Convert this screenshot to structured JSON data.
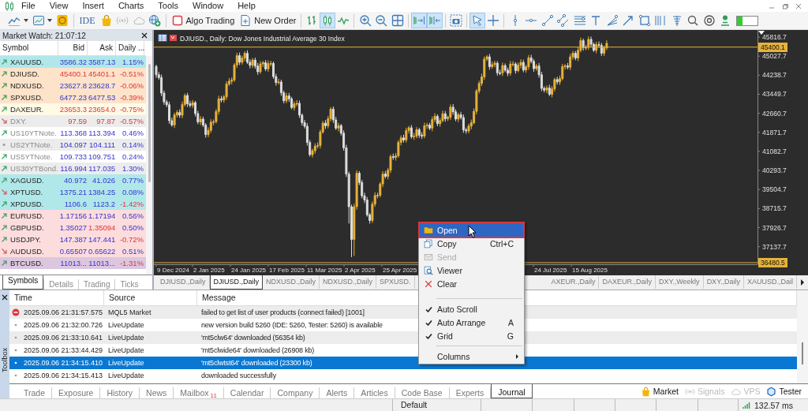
{
  "menu": {
    "items": [
      "File",
      "View",
      "Insert",
      "Charts",
      "Tools",
      "Window",
      "Help"
    ]
  },
  "toolbar": {
    "ide": {
      "label": "IDE"
    },
    "algo_trading": {
      "label": "Algo Trading",
      "on": false
    },
    "new_order": {
      "label": "New Order"
    },
    "chart_types": [
      {
        "selected": false
      },
      {
        "selected": true
      },
      {
        "selected": false
      }
    ],
    "chart_options": [
      {
        "selected": true
      },
      {
        "selected": true
      }
    ],
    "cursor_tools": [
      {
        "selected": true
      },
      {
        "selected": false
      }
    ],
    "meter": {
      "level": 0.25
    }
  },
  "market_watch": {
    "title": "Market Watch: 21:07:12",
    "columns": [
      "Symbol",
      "Bid",
      "Ask",
      "Daily ..."
    ],
    "rows": [
      {
        "symbol": "XAUUSD.",
        "kind": "up",
        "dimmed": false,
        "bid": "3586.32",
        "ask": "3587.13",
        "change": "1.15%",
        "bid_up": true,
        "ask_up": true,
        "change_up": true,
        "color": "#b0e8ea"
      },
      {
        "symbol": "DJIUSD.",
        "kind": "up",
        "dimmed": false,
        "bid": "45400.1",
        "ask": "45401.1",
        "change": "-0.51%",
        "bid_up": false,
        "ask_up": false,
        "change_up": false,
        "color": "#fde3c9"
      },
      {
        "symbol": "NDXUSD.",
        "kind": "up",
        "dimmed": false,
        "bid": "23627.8",
        "ask": "23628.7",
        "change": "-0.06%",
        "bid_up": true,
        "ask_up": true,
        "change_up": false,
        "color": "#fde3c9"
      },
      {
        "symbol": "SPXUSD.",
        "kind": "up",
        "dimmed": false,
        "bid": "6477.23",
        "ask": "6477.53",
        "change": "-0.39%",
        "bid_up": true,
        "ask_up": true,
        "change_up": false,
        "color": "#fde3c9"
      },
      {
        "symbol": "DAXEUR.",
        "kind": "up",
        "dimmed": false,
        "bid": "23653.3",
        "ask": "23654.0",
        "change": "-0.75%",
        "bid_up": false,
        "ask_up": false,
        "change_up": false,
        "color": "#fffae6"
      },
      {
        "symbol": "DXY.",
        "kind": "down",
        "dimmed": true,
        "bid": "97.59",
        "ask": "97.87",
        "change": "-0.57%",
        "bid_up": false,
        "ask_up": false,
        "change_up": false,
        "color": "#ececec"
      },
      {
        "symbol": "US10YTNote.",
        "kind": "up",
        "dimmed": true,
        "bid": "113.368",
        "ask": "113.394",
        "change": "0.46%",
        "bid_up": true,
        "ask_up": true,
        "change_up": true,
        "color": "#ffffff"
      },
      {
        "symbol": "US2YTNote.",
        "kind": "flat",
        "dimmed": true,
        "bid": "104.097",
        "ask": "104.111",
        "change": "0.14%",
        "bid_up": true,
        "ask_up": true,
        "change_up": true,
        "color": "#ececec"
      },
      {
        "symbol": "US5YTNote.",
        "kind": "up",
        "dimmed": true,
        "bid": "109.733",
        "ask": "109.751",
        "change": "0.24%",
        "bid_up": true,
        "ask_up": true,
        "change_up": true,
        "color": "#ffffff"
      },
      {
        "symbol": "US30YTBond.",
        "kind": "up",
        "dimmed": true,
        "bid": "116.994",
        "ask": "117.035",
        "change": "1.30%",
        "bid_up": true,
        "ask_up": true,
        "change_up": true,
        "color": "#ececec"
      },
      {
        "symbol": "XAGUSD.",
        "kind": "up",
        "dimmed": false,
        "bid": "40.972",
        "ask": "41.026",
        "change": "0.77%",
        "bid_up": true,
        "ask_up": true,
        "change_up": true,
        "color": "#b0e8ea"
      },
      {
        "symbol": "XPTUSD.",
        "kind": "down",
        "dimmed": false,
        "bid": "1375.21",
        "ask": "1384.25",
        "change": "0.08%",
        "bid_up": true,
        "ask_up": true,
        "change_up": true,
        "color": "#b0e8ea"
      },
      {
        "symbol": "XPDUSD.",
        "kind": "up",
        "dimmed": false,
        "bid": "1106.6",
        "ask": "1123.2",
        "change": "-1.42%",
        "bid_up": true,
        "ask_up": true,
        "change_up": false,
        "color": "#b0e8ea"
      },
      {
        "symbol": "EURUSD.",
        "kind": "up",
        "dimmed": false,
        "bid": "1.17156",
        "ask": "1.17194",
        "change": "0.56%",
        "bid_up": true,
        "ask_up": true,
        "change_up": true,
        "color": "#fcdcdc"
      },
      {
        "symbol": "GBPUSD.",
        "kind": "up",
        "dimmed": false,
        "bid": "1.35027",
        "ask": "1.35094",
        "change": "0.50%",
        "bid_up": true,
        "ask_up": false,
        "change_up": true,
        "color": "#fcdcdc"
      },
      {
        "symbol": "USDJPY.",
        "kind": "up",
        "dimmed": false,
        "bid": "147.387",
        "ask": "147.441",
        "change": "-0.72%",
        "bid_up": true,
        "ask_up": true,
        "change_up": false,
        "color": "#fcdcdc"
      },
      {
        "symbol": "AUDUSD.",
        "kind": "down",
        "dimmed": false,
        "bid": "0.65507",
        "ask": "0.65622",
        "change": "0.51%",
        "bid_up": true,
        "ask_up": true,
        "change_up": true,
        "color": "#fcdcdc"
      },
      {
        "symbol": "BTCUSD.",
        "kind": "up",
        "dimmed": false,
        "bid": "11013...",
        "ask": "11013...",
        "change": "-1.31%",
        "bid_up": true,
        "ask_up": true,
        "change_up": false,
        "color": "#dcc6e0"
      }
    ],
    "tabs": [
      {
        "label": "Symbols",
        "selected": true
      },
      {
        "label": "Details",
        "selected": false
      },
      {
        "label": "Trading",
        "selected": false
      },
      {
        "label": "Ticks",
        "selected": false
      }
    ]
  },
  "chart": {
    "title": "DJIUSD., Daily:  Dow Jones Industrial Average 30 Index",
    "price_ticks": [
      "45816.7",
      "45027.7",
      "44238.7",
      "43449.7",
      "42660.7",
      "41871.7",
      "41082.7",
      "40293.7",
      "39504.7",
      "38715.7",
      "37926.7",
      "37137.7"
    ],
    "price_lines": [
      "45400.1",
      "36480.5"
    ],
    "dates": [
      "9 Dec 2024",
      "2 Jan 2025",
      "24 Jan 2025",
      "17 Feb 2025",
      "11 Mar 2025",
      "2 Apr 2025",
      "25 Apr 2025",
      "24 Jul 2025",
      "15 Aug 2025"
    ],
    "tabs": [
      {
        "label": "DJIUSD.,Daily",
        "selected": false
      },
      {
        "label": "DJIUSD.,Daily",
        "selected": true
      },
      {
        "label": "NDXUSD.,Daily",
        "selected": false
      },
      {
        "label": "NDXUSD.,Daily",
        "selected": false
      },
      {
        "label": "SPXUSD.",
        "selected": false
      },
      {
        "label": "AXEUR.,Daily",
        "selected": false
      },
      {
        "label": "DAXEUR.,Daily",
        "selected": false
      },
      {
        "label": "DXY.,Weekly",
        "selected": false
      },
      {
        "label": "DXY.,Daily",
        "selected": false
      },
      {
        "label": "XAUUSD.,Dail",
        "selected": false
      }
    ]
  },
  "context_menu": {
    "items": [
      {
        "kind": "action",
        "label": "Open",
        "selected": true,
        "disabled": false
      },
      {
        "kind": "action",
        "label": "Copy",
        "shortcut": "Ctrl+C",
        "selected": false,
        "disabled": false
      },
      {
        "kind": "action",
        "label": "Send",
        "selected": false,
        "disabled": true
      },
      {
        "kind": "action",
        "label": "Viewer",
        "selected": false,
        "disabled": false
      },
      {
        "kind": "action",
        "label": "Clear",
        "selected": false,
        "disabled": false
      },
      {
        "kind": "separator"
      },
      {
        "kind": "check",
        "label": "Auto Scroll",
        "checked": true,
        "selected": false,
        "disabled": false
      },
      {
        "kind": "check",
        "label": "Auto Arrange",
        "shortcut": "A",
        "checked": true,
        "selected": false,
        "disabled": false
      },
      {
        "kind": "check",
        "label": "Grid",
        "shortcut": "G",
        "checked": true,
        "selected": false,
        "disabled": false
      },
      {
        "kind": "separator"
      },
      {
        "kind": "submenu",
        "label": "Columns",
        "selected": false,
        "disabled": false
      }
    ]
  },
  "toolbox": {
    "label": "Toolbox",
    "columns": [
      "Time",
      "Source",
      "Message"
    ],
    "rows": [
      {
        "kind": "error",
        "time": "2025.09.06 21:31:57.575",
        "source": "MQL5 Market",
        "message": "failed to get list of user products (connect failed) [1001]",
        "selected": false
      },
      {
        "kind": "info",
        "time": "2025.09.06 21:32:00.726",
        "source": "LiveUpdate",
        "message": "new version build 5260 (IDE: 5260, Tester: 5260) is available",
        "selected": false
      },
      {
        "kind": "info",
        "time": "2025.09.06 21:33:10.641",
        "source": "LiveUpdate",
        "message": "'mt5clw64' downloaded (56354 kb)",
        "selected": false
      },
      {
        "kind": "info",
        "time": "2025.09.06 21:33:44.429",
        "source": "LiveUpdate",
        "message": "'mt5clwide64' downloaded (26908 kb)",
        "selected": false
      },
      {
        "kind": "info",
        "time": "2025.09.06 21:34:15.410",
        "source": "LiveUpdate",
        "message": "'mt5clwtst64' downloaded (23300 kb)",
        "selected": true
      },
      {
        "kind": "info",
        "time": "2025.09.06 21:34:15.413",
        "source": "LiveUpdate",
        "message": "downloaded successfully",
        "selected": false
      }
    ],
    "tabs": [
      {
        "label": "Trade",
        "selected": false
      },
      {
        "label": "Exposure",
        "selected": false
      },
      {
        "label": "History",
        "selected": false
      },
      {
        "label": "News",
        "selected": false
      },
      {
        "label": "Mailbox",
        "badge": "11",
        "selected": false
      },
      {
        "label": "Calendar",
        "selected": false
      },
      {
        "label": "Company",
        "selected": false
      },
      {
        "label": "Alerts",
        "selected": false
      },
      {
        "label": "Articles",
        "selected": false
      },
      {
        "label": "Code Base",
        "selected": false
      },
      {
        "label": "Experts",
        "selected": false
      },
      {
        "label": "Journal",
        "selected": true
      }
    ],
    "links": [
      {
        "label": "Market",
        "disabled": false
      },
      {
        "label": "Signals",
        "disabled": true
      },
      {
        "label": "VPS",
        "disabled": true
      },
      {
        "label": "Tester",
        "disabled": false
      }
    ]
  },
  "status_bar": {
    "profile": "Default",
    "ping": "132.57 ms"
  }
}
